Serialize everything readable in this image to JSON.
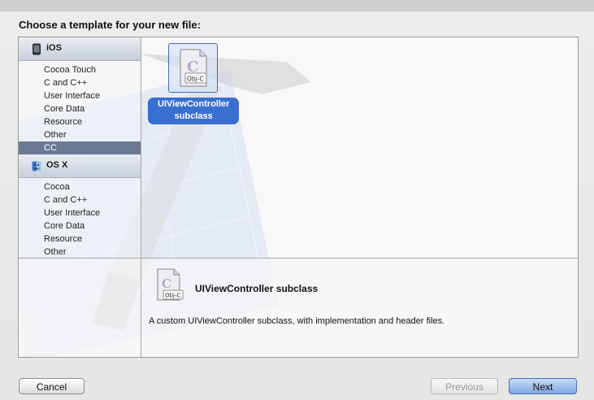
{
  "dialog": {
    "heading": "Choose a template for your new file:"
  },
  "sidebar": {
    "ios": {
      "label": "iOS",
      "items": [
        "Cocoa Touch",
        "C and C++",
        "User Interface",
        "Core Data",
        "Resource",
        "Other",
        "CC"
      ],
      "selected": "CC"
    },
    "osx": {
      "label": "OS X",
      "items": [
        "Cocoa",
        "C and C++",
        "User Interface",
        "Core Data",
        "Resource",
        "Other"
      ]
    }
  },
  "templates": [
    {
      "label_line1": "UIViewController",
      "label_line2": "subclass",
      "icon": "objc-file-icon",
      "badge": "Obj-C"
    }
  ],
  "description": {
    "title": "UIViewController subclass",
    "text": "A custom UIViewController subclass, with implementation and header files.",
    "badge": "Obj-C"
  },
  "buttons": {
    "cancel": "Cancel",
    "previous": "Previous",
    "next": "Next"
  },
  "colors": {
    "selection": "#6b7993",
    "template_highlight": "#3a6fd2",
    "default_button": "#7fa7e3"
  }
}
